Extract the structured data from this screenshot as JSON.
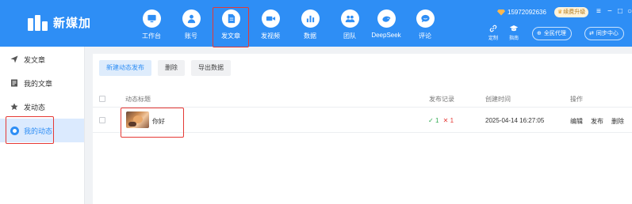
{
  "header": {
    "app_name": "新媒加",
    "nav": [
      {
        "label": "工作台",
        "icon": "monitor-icon",
        "active": false
      },
      {
        "label": "账号",
        "icon": "user-icon",
        "active": false
      },
      {
        "label": "发文章",
        "icon": "document-icon",
        "active": true
      },
      {
        "label": "发视频",
        "icon": "video-camera-icon",
        "active": false
      },
      {
        "label": "数据",
        "icon": "bar-chart-icon",
        "active": false
      },
      {
        "label": "团队",
        "icon": "team-icon",
        "active": false
      },
      {
        "label": "DeepSeek",
        "icon": "whale-icon",
        "active": false
      },
      {
        "label": "评论",
        "icon": "comment-icon",
        "active": false
      }
    ],
    "phone": "15972092636",
    "upgrade_label": "续费升级",
    "window_controls": {
      "menu": "≡",
      "minimize": "−",
      "maximize": "□",
      "close": "○"
    },
    "tools": [
      {
        "label": "定制",
        "icon": "link-icon"
      },
      {
        "label": "指南",
        "icon": "graduation-cap-icon"
      }
    ],
    "agent_label": "全民代理",
    "sync_label": "同步中心"
  },
  "sidebar": {
    "items": [
      {
        "label": "发文章",
        "icon": "send-icon",
        "active": false
      },
      {
        "label": "我的文章",
        "icon": "article-icon",
        "active": false
      },
      {
        "label": "发动态",
        "icon": "star-icon",
        "active": false
      },
      {
        "label": "我的动态",
        "icon": "circle-dot-icon",
        "active": true
      }
    ]
  },
  "toolbar": {
    "new_label": "新建动态发布",
    "delete_label": "删除",
    "export_label": "导出数据"
  },
  "table": {
    "headers": {
      "title": "动态标题",
      "record": "发布记录",
      "created": "创建时间",
      "actions": "操作"
    },
    "rows": [
      {
        "title": "你好",
        "success_count": "1",
        "fail_count": "1",
        "created": "2025-04-14 16:27:05",
        "actions": [
          "编辑",
          "发布",
          "删除"
        ]
      }
    ]
  },
  "colors": {
    "brand": "#2e8ef5",
    "highlight": "#e53935",
    "success": "#2eaa4f",
    "fail": "#e53935"
  }
}
